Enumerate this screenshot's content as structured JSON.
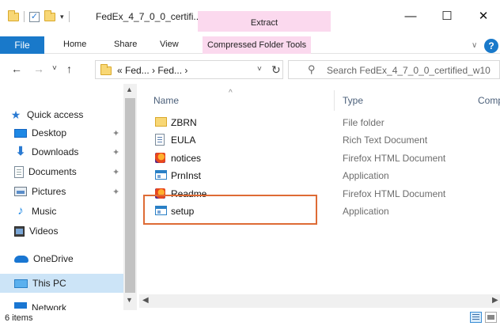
{
  "window": {
    "title": "FedEx_4_7_0_0_certifi...",
    "contextual_tab": "Extract",
    "minimize": "—",
    "maximize": "☐",
    "close": "✕"
  },
  "ribbon": {
    "tabs": [
      "File",
      "Home",
      "Share",
      "View",
      "Compressed Folder Tools"
    ],
    "collapse_icon": "∨",
    "help_icon": "?"
  },
  "addressbar": {
    "path": "« Fed... › Fed... ›",
    "search_placeholder": "Search FedEx_4_7_0_0_certified_w10",
    "back_icon": "←",
    "forward_icon": "→",
    "history_icon": "˅",
    "up_icon": "↑",
    "dropdown_icon": "˅",
    "refresh_icon": "↻"
  },
  "navpane": {
    "items": [
      {
        "label": "Quick access",
        "icon": "star-icon",
        "pinned": false
      },
      {
        "label": "Desktop",
        "icon": "desktop-icon",
        "pinned": true
      },
      {
        "label": "Downloads",
        "icon": "download-icon",
        "pinned": true
      },
      {
        "label": "Documents",
        "icon": "document-icon",
        "pinned": true
      },
      {
        "label": "Pictures",
        "icon": "pictures-icon",
        "pinned": true
      },
      {
        "label": "Music",
        "icon": "music-icon",
        "pinned": false
      },
      {
        "label": "Videos",
        "icon": "videos-icon",
        "pinned": false
      },
      {
        "label": "OneDrive",
        "icon": "cloud-icon",
        "pinned": false
      },
      {
        "label": "This PC",
        "icon": "computer-icon",
        "pinned": false,
        "selected": true
      },
      {
        "label": "Network",
        "icon": "network-icon",
        "pinned": false
      }
    ]
  },
  "filelist": {
    "columns": [
      "Name",
      "Type",
      "Comp"
    ],
    "rows": [
      {
        "name": "ZBRN",
        "type": "File folder",
        "icon": "folder-icon"
      },
      {
        "name": "EULA",
        "type": "Rich Text Document",
        "icon": "rtf-document-icon"
      },
      {
        "name": "notices",
        "type": "Firefox HTML Document",
        "icon": "firefox-icon"
      },
      {
        "name": "PrnInst",
        "type": "Application",
        "icon": "application-icon"
      },
      {
        "name": "Readme",
        "type": "Firefox HTML Document",
        "icon": "firefox-icon"
      },
      {
        "name": "setup",
        "type": "Application",
        "icon": "application-icon",
        "highlighted": true
      }
    ]
  },
  "statusbar": {
    "item_count": "6 items"
  },
  "colors": {
    "accent": "#1979ca",
    "contextual_tab": "#fbd9ee",
    "highlight_box": "#de6b35",
    "selection": "#cce4f7"
  }
}
